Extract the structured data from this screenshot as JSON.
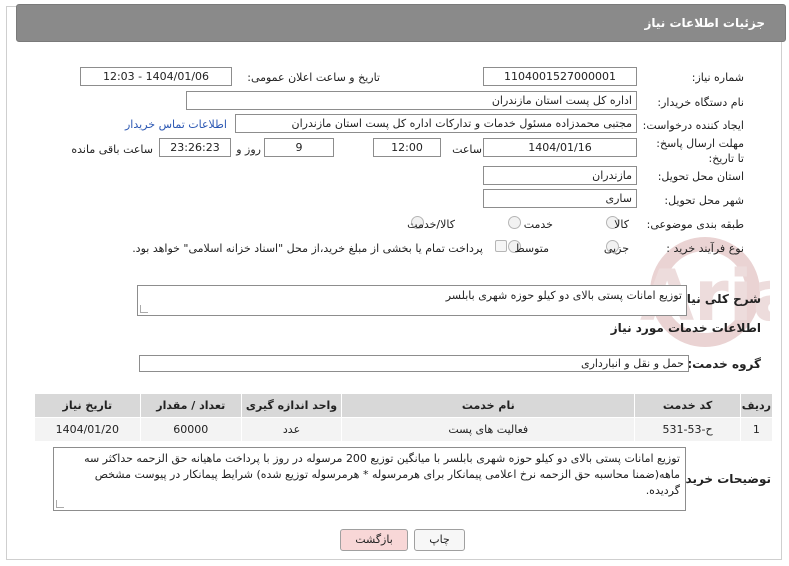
{
  "header": {
    "title": "جزئیات اطلاعات نیاز"
  },
  "fields": {
    "need_number_label": "شماره نیاز:",
    "need_number": "1104001527000001",
    "announce_label": "تاریخ و ساعت اعلان عمومی:",
    "announce_value": "1404/01/06 - 12:03",
    "buyer_org_label": "نام دستگاه خریدار:",
    "buyer_org": "اداره کل پست استان مازندران",
    "creator_label": "ایجاد کننده درخواست:",
    "creator": "مجتبی محمدزاده مسئول خدمات و تدارکات اداره کل پست استان مازندران",
    "contact_link": "اطلاعات تماس خریدار",
    "deadline_label": "مهلت ارسال پاسخ: تا تاریخ:",
    "deadline_date": "1404/01/16",
    "time_label": "ساعت",
    "deadline_time": "12:00",
    "days_value": "9",
    "days_label": "روز و",
    "remaining_time": "23:26:23",
    "remaining_label": "ساعت باقی مانده",
    "province_label": "استان محل تحویل:",
    "province": "مازندران",
    "city_label": "شهر محل تحویل:",
    "city": "ساری",
    "category_label": "طبقه بندی موضوعی:",
    "category_options": [
      "کالا",
      "خدمت",
      "کالا/خدمت"
    ],
    "process_label": "نوع فرآیند خرید :",
    "process_options": [
      "جزیی",
      "متوسط"
    ],
    "payment_note": "پرداخت تمام یا بخشی از مبلغ خرید،از محل \"اسناد خزانه اسلامی\" خواهد بود."
  },
  "description": {
    "label": "شرح کلی نیاز:",
    "text": "توزیع امانات پستی  بالای دو کیلو حوزه شهری بابلسر"
  },
  "services": {
    "section_title": "اطلاعات خدمات مورد نیاز",
    "group_label": "گروه خدمت:",
    "group_value": "حمل و نقل و انبارداری",
    "columns": [
      "ردیف",
      "کد خدمت",
      "نام خدمت",
      "واحد اندازه گیری",
      "تعداد / مقدار",
      "تاریخ نیاز"
    ],
    "rows": [
      [
        "1",
        "ح-53-531",
        "فعالیت های پست",
        "عدد",
        "60000",
        "1404/01/20"
      ]
    ]
  },
  "buyer_notes": {
    "label": "توضیحات خریدار:",
    "text": "توزیع امانات پستی  بالای دو کیلو حوزه شهری بابلسر با میانگین توزیع 200 مرسوله در روز با پرداخت ماهیانه حق الزحمه حداکثر سه ماهه(ضمنا محاسبه حق الزحمه نرخ اعلامی پیمانکار برای هرمرسوله * هرمرسوله توزیع شده) شرایط پیمانکار در پیوست مشخص گردیده."
  },
  "buttons": {
    "print": "چاپ",
    "back": "بازگشت"
  },
  "watermark": {
    "text": "AriaTender.neT"
  },
  "colors": {
    "header_bg": "#8a8a8a",
    "back_button_bg": "#f8d7d7",
    "link": "#2b57b3",
    "watermark": "#e7c9c9"
  }
}
